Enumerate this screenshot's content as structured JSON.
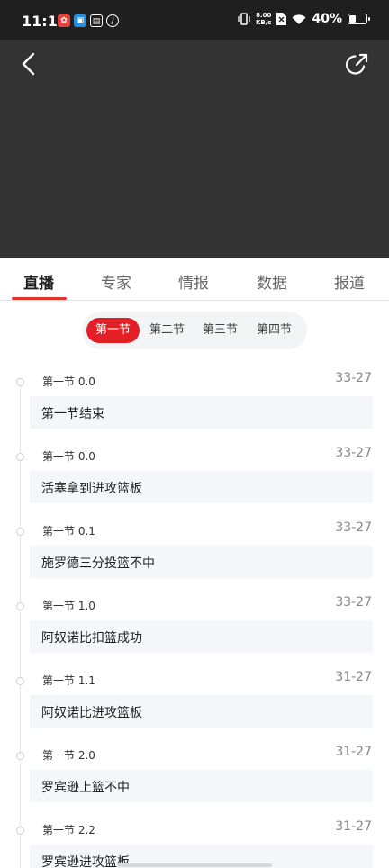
{
  "status_bar": {
    "time": "11:13",
    "net_speed_value": "8.00",
    "net_speed_unit": "KB/s",
    "battery_text": "40%",
    "battery_level": 0.4
  },
  "tabs": [
    "直播",
    "专家",
    "情报",
    "数据",
    "报道"
  ],
  "active_tab": "直播",
  "periods": [
    "第一节",
    "第二节",
    "第三节",
    "第四节"
  ],
  "active_period": "第一节",
  "events": [
    {
      "time": "第一节 0.0",
      "score": "33-27",
      "text": "第一节结束"
    },
    {
      "time": "第一节 0.0",
      "score": "33-27",
      "text": "活塞拿到进攻篮板"
    },
    {
      "time": "第一节 0.1",
      "score": "33-27",
      "text": "施罗德三分投篮不中"
    },
    {
      "time": "第一节 1.0",
      "score": "33-27",
      "text": "阿奴诺比扣篮成功"
    },
    {
      "time": "第一节 1.1",
      "score": "31-27",
      "text": "阿奴诺比进攻篮板"
    },
    {
      "time": "第一节 2.0",
      "score": "31-27",
      "text": "罗宾逊上篮不中"
    },
    {
      "time": "第一节 2.2",
      "score": "31-27",
      "text": "罗宾逊进攻篮板"
    }
  ],
  "colors": {
    "accent": "#e31e25",
    "video_bg": "#333333",
    "status_bg": "#1f1f1f"
  }
}
